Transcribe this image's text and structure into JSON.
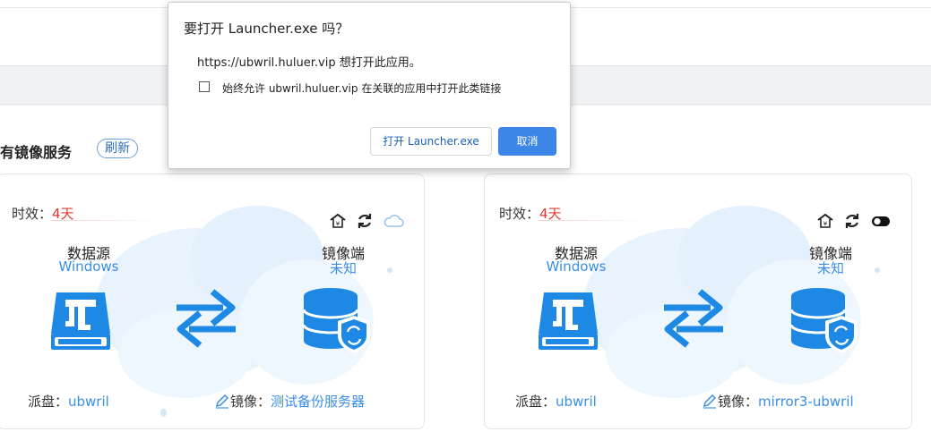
{
  "page": {
    "section_title": "所有镜像服务",
    "refresh_label": "刷新"
  },
  "cards": [
    {
      "validity_label": "时效：",
      "validity_value": "4天",
      "status_icons": [
        "home-icon",
        "sync-icon",
        "cloud-icon"
      ],
      "source_label": "数据源",
      "source_value": "Windows",
      "mirror_label": "镜像端",
      "mirror_value": "未知",
      "disk_label": "派盘：",
      "disk_value": "ubwril",
      "image_label": "镜像：",
      "image_value": "测试备份服务器"
    },
    {
      "validity_label": "时效：",
      "validity_value": "4天",
      "status_icons": [
        "home-icon",
        "sync-icon",
        "toggle-icon"
      ],
      "source_label": "数据源",
      "source_value": "Windows",
      "mirror_label": "镜像端",
      "mirror_value": "未知",
      "disk_label": "派盘：",
      "disk_value": "ubwril",
      "image_label": "镜像：",
      "image_value": "mirror3-ubwril"
    }
  ],
  "dialog": {
    "title": "要打开 Launcher.exe 吗？",
    "message": "https://ubwril.huluer.vip 想打开此应用。",
    "checkbox_label": "始终允许 ubwril.huluer.vip 在关联的应用中打开此类链接",
    "checkbox_checked": false,
    "open_button": "打开 Launcher.exe",
    "cancel_button": "取消"
  },
  "colors": {
    "accent": "#3a8ee6",
    "validity": "#e03a2f",
    "primary_button": "#3b86e6"
  }
}
